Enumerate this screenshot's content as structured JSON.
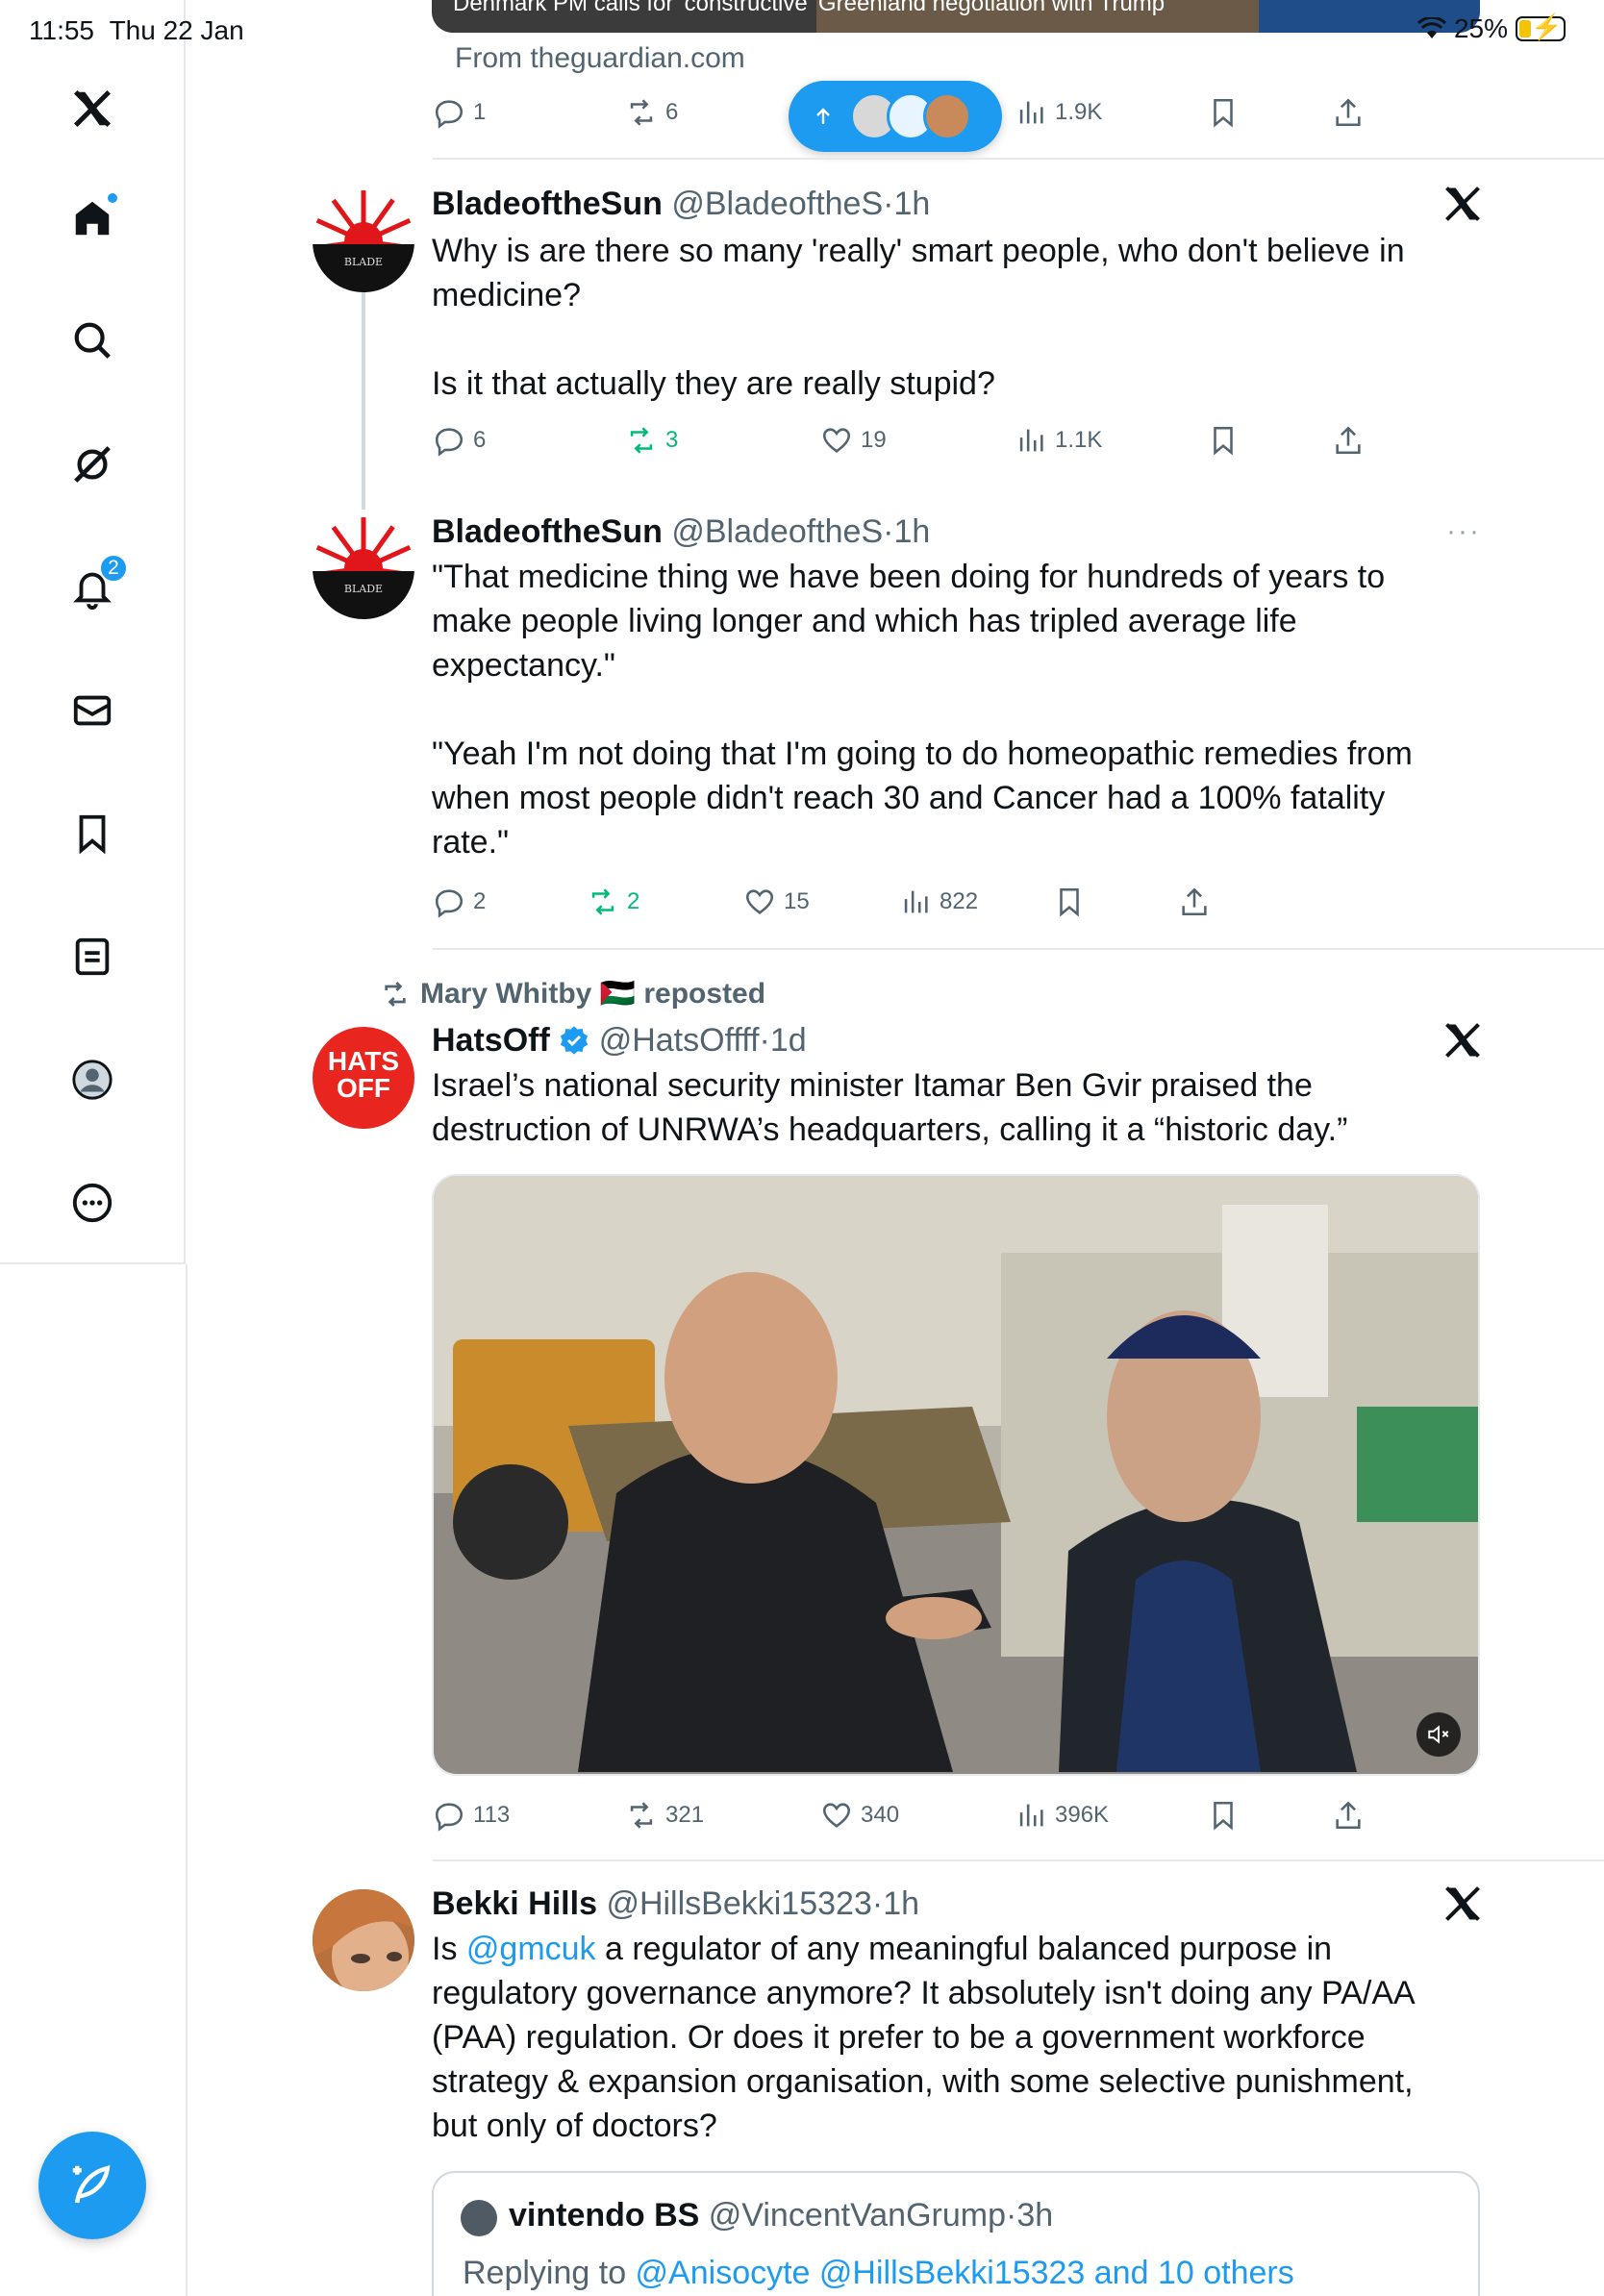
{
  "status_bar": {
    "time": "11:55",
    "date": "Thu 22 Jan",
    "battery": "25%",
    "wifi_icon": "wifi-icon",
    "battery_icon": "battery-charging-icon"
  },
  "sidebar": {
    "items": [
      {
        "name": "x-logo",
        "icon": "x-logo-icon"
      },
      {
        "name": "home",
        "icon": "home-icon"
      },
      {
        "name": "explore",
        "icon": "search-icon"
      },
      {
        "name": "grok",
        "icon": "grok-icon"
      },
      {
        "name": "notifications",
        "icon": "bell-icon",
        "badge": "2"
      },
      {
        "name": "messages",
        "icon": "envelope-icon"
      },
      {
        "name": "bookmarks",
        "icon": "bookmark-icon"
      },
      {
        "name": "lists",
        "icon": "list-icon"
      },
      {
        "name": "profile",
        "icon": "profile-icon"
      },
      {
        "name": "more",
        "icon": "more-icon"
      }
    ],
    "compose_icon": "compose-icon"
  },
  "top_post": {
    "card_title": "Denmark PM calls for 'constructive' Greenland negotiation with Trump",
    "source": "From theguardian.com",
    "replies": "1",
    "reposts": "6",
    "views": "1.9K"
  },
  "new_posts_pill": {
    "arrow_icon": "arrow-up-icon"
  },
  "posts": [
    {
      "name": "BladeoftheSun",
      "handle": "@BladeoftheS",
      "time": "1h",
      "paragraphs": [
        "Why is are there so many 'really' smart people, who don't believe in medicine?",
        "Is it that actually they are really stupid?"
      ],
      "replies": "6",
      "reposts": "3",
      "likes": "19",
      "views": "1.1K"
    },
    {
      "name": "BladeoftheSun",
      "handle": "@BladeoftheS",
      "time": "1h",
      "paragraphs": [
        "\"That medicine thing we have been doing for hundreds of years to make people living longer and which has tripled average life expectancy.\"",
        "\"Yeah I'm not doing that I'm going to do homeopathic remedies from when most people didn't reach 30 and Cancer had a 100% fatality rate.\""
      ],
      "replies": "2",
      "reposts": "2",
      "likes": "15",
      "views": "822"
    },
    {
      "repost_label": "Mary Whitby 🇵🇸 reposted",
      "name": "HatsOff",
      "handle": "@HatsOffff",
      "time": "1d",
      "avatar_text": "HATS OFF",
      "text": "Israel’s national security minister Itamar Ben Gvir praised the destruction of UNRWA’s headquarters, calling it a “historic day.”",
      "replies": "113",
      "reposts": "321",
      "likes": "340",
      "views": "396K"
    },
    {
      "name": "Bekki Hills",
      "handle": "@HillsBekki15323",
      "time": "1h",
      "text_prefix": "Is ",
      "mention": "@gmcuk",
      "text_suffix": " a regulator of any meaningful balanced purpose in regulatory governance anymore? It absolutely isn't doing any PA/AA (PAA) regulation. Or does it prefer to be a government workforce strategy & expansion organisation, with some selective punishment, but only of doctors?",
      "quote": {
        "name": "vintendo BS",
        "handle": "@VincentVanGrump",
        "time": "3h",
        "replying_prefix": "Replying to ",
        "replying_to": "@Anisocyte @HillsBekki15323 and 10 others"
      }
    }
  ]
}
